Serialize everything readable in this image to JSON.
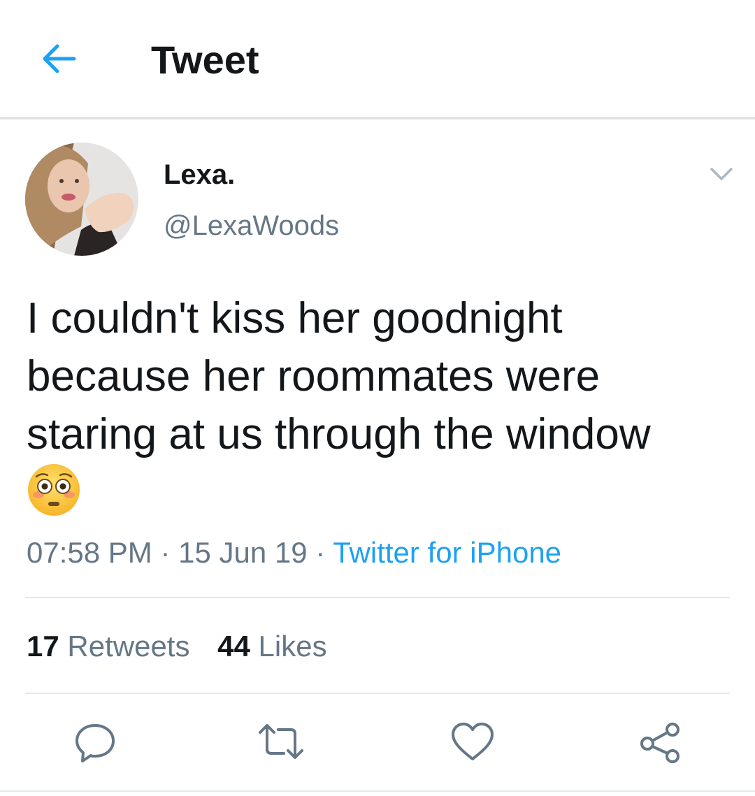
{
  "header": {
    "title": "Tweet",
    "back_icon": "arrow-left-icon"
  },
  "colors": {
    "accent": "#1da1f2",
    "secondary_text": "#657786",
    "primary_text": "#14171a",
    "divider": "#e1e8ed"
  },
  "tweet": {
    "author": {
      "name": "Lexa.",
      "handle": "@LexaWoods"
    },
    "text_lines": [
      "I couldn't kiss her goodnight",
      "because her roommates were",
      "staring at us through the window"
    ],
    "emoji": "flushed-face",
    "time": "07:58 PM",
    "date": "15 Jun 19",
    "separator": "·",
    "source": "Twitter for iPhone"
  },
  "stats": {
    "retweets": {
      "count": "17",
      "label": "Retweets"
    },
    "likes": {
      "count": "44",
      "label": "Likes"
    }
  },
  "actions": [
    "reply-icon",
    "retweet-icon",
    "like-icon",
    "share-icon"
  ]
}
